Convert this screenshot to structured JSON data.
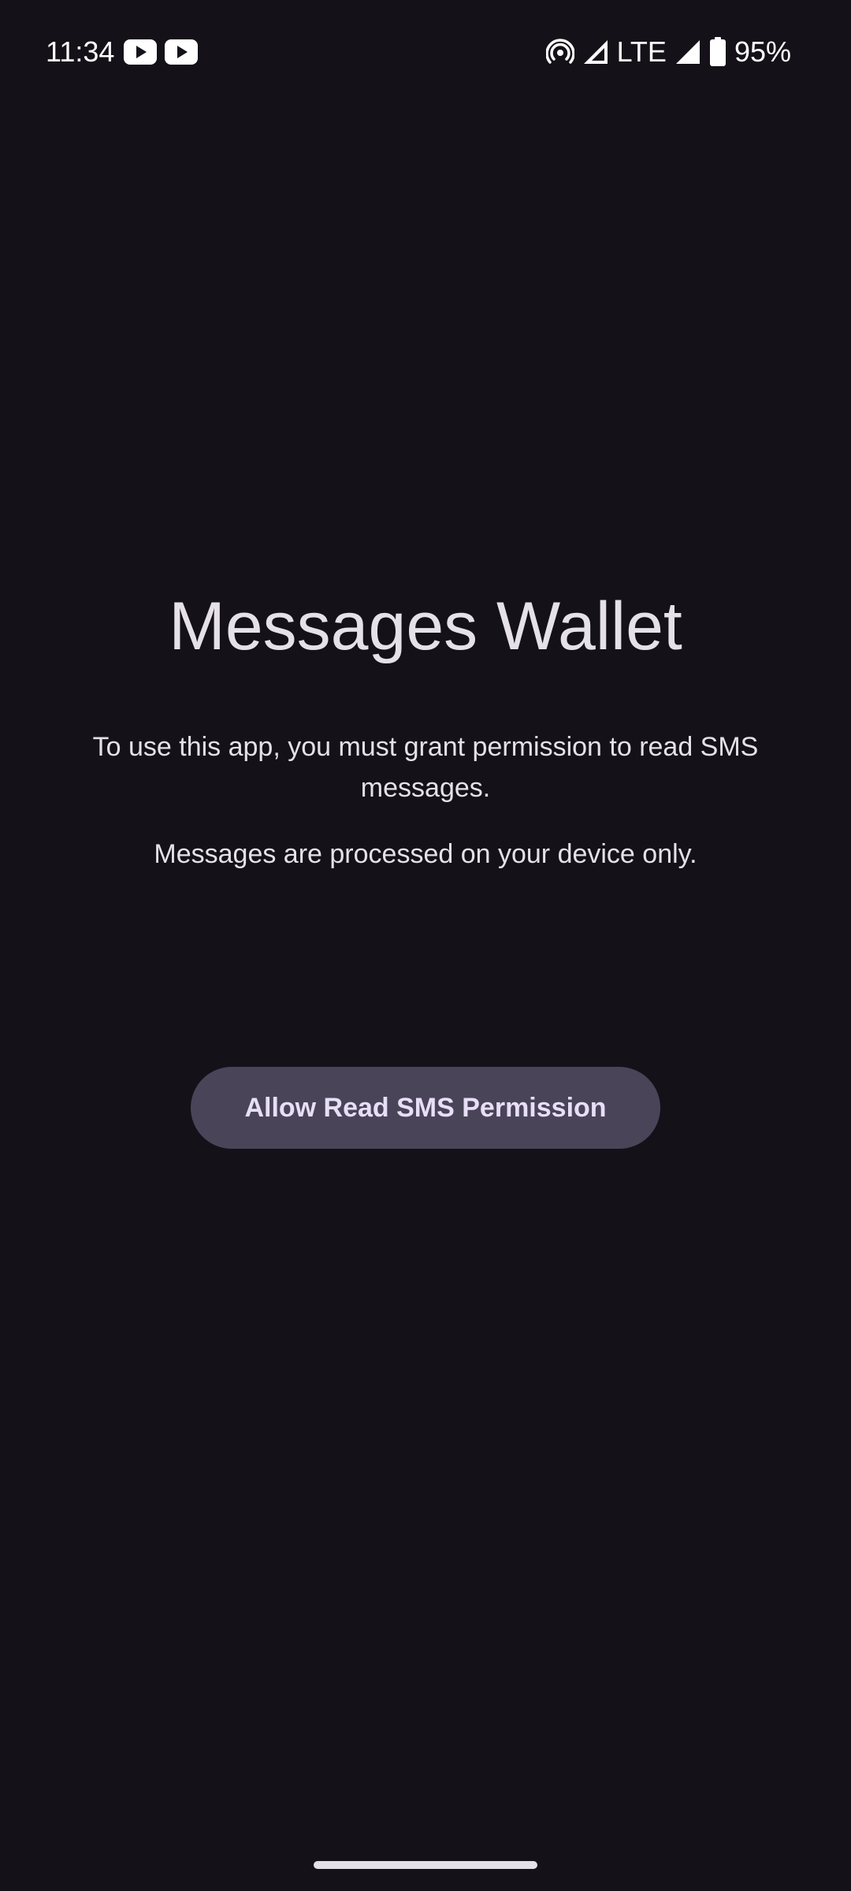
{
  "status_bar": {
    "time": "11:34",
    "notifications": [
      "youtube-icon",
      "youtube-icon"
    ],
    "indicators": [
      "hotspot-icon",
      "signal-icon",
      "signal-icon",
      "battery-icon"
    ],
    "network_label": "LTE",
    "battery_percent": "95%"
  },
  "main": {
    "title": "Messages Wallet",
    "permission_text": "To use this app, you must grant permission to read SMS messages.",
    "privacy_text": "Messages are processed on your device only.",
    "allow_button_label": "Allow Read SMS Permission"
  },
  "colors": {
    "background": "#141218",
    "text": "#E6E0E9",
    "button_bg": "#4A4458",
    "button_text": "#E8DEF8"
  }
}
